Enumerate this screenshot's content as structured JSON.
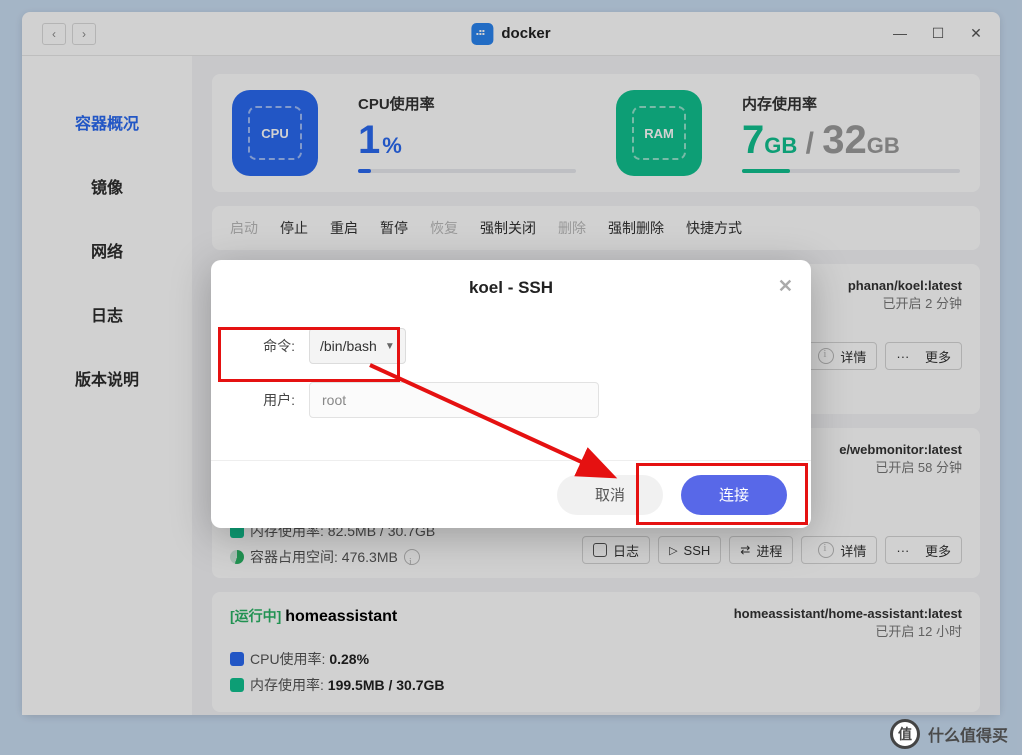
{
  "titlebar": {
    "title": "docker"
  },
  "sidebar": {
    "items": [
      {
        "label": "容器概况"
      },
      {
        "label": "镜像"
      },
      {
        "label": "网络"
      },
      {
        "label": "日志"
      },
      {
        "label": "版本说明"
      }
    ]
  },
  "stats": {
    "cpu_label": "CPU使用率",
    "cpu_value": "1",
    "cpu_unit": "%",
    "ram_label": "内存使用率",
    "ram_used": "7",
    "ram_used_unit": "GB",
    "ram_sep": "/",
    "ram_total": "32",
    "ram_total_unit": "GB",
    "chip_cpu": "CPU",
    "chip_ram": "RAM"
  },
  "toolbar": {
    "items": [
      "启动",
      "停止",
      "重启",
      "暂停",
      "恢复",
      "强制关闭",
      "删除",
      "强制删除",
      "快捷方式"
    ]
  },
  "containers": [
    {
      "image": "phanan/koel:latest",
      "uptime": "已开启 2 分钟",
      "btn_detail": "详情",
      "btn_more": "更多",
      "memline": "内存使用率:  82.5MB / 30.7GB",
      "diskline": "容器占用空间:  476.3MB"
    },
    {
      "image": "e/webmonitor:latest",
      "uptime": "已开启 58 分钟",
      "btn_log": "日志",
      "btn_ssh": "SSH",
      "btn_proc": "进程",
      "btn_detail": "详情",
      "btn_more": "更多"
    },
    {
      "run": "[运行中]",
      "name": "homeassistant",
      "image": "homeassistant/home-assistant:latest",
      "uptime": "已开启 12 小时",
      "cpu_label": "CPU使用率:",
      "cpu_val": "0.28%",
      "mem_label": "内存使用率:",
      "mem_val": "199.5MB / 30.7GB"
    }
  ],
  "modal": {
    "title": "koel - SSH",
    "cmd_label": "命令:",
    "cmd_value": "/bin/bash",
    "user_label": "用户:",
    "user_value": "root",
    "cancel": "取消",
    "ok": "连接"
  },
  "watermark": {
    "badge": "值",
    "text": "什么值得买"
  },
  "dots": "···"
}
